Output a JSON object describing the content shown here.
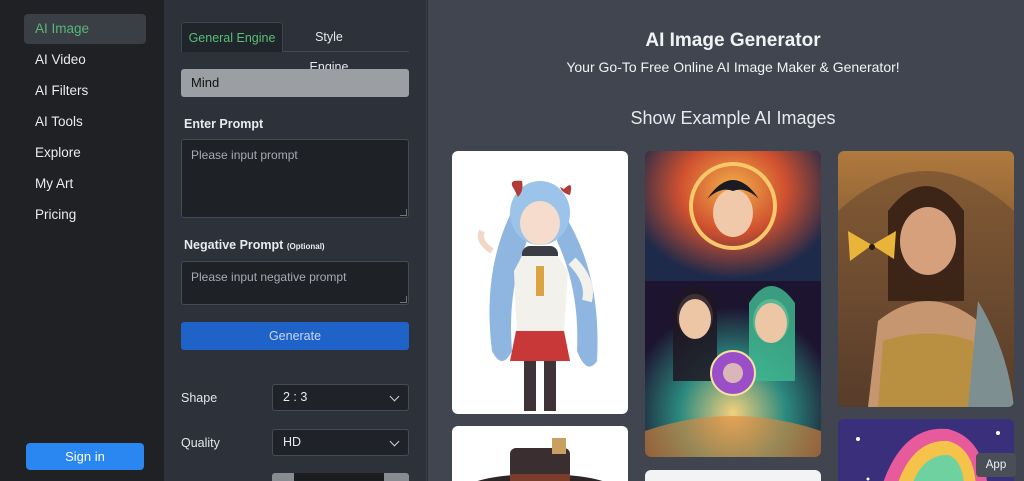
{
  "nav": {
    "items": [
      {
        "label": "AI Image",
        "active": true
      },
      {
        "label": "AI Video"
      },
      {
        "label": "AI Filters"
      },
      {
        "label": "AI Tools"
      },
      {
        "label": "Explore"
      },
      {
        "label": "My Art"
      },
      {
        "label": "Pricing"
      }
    ],
    "signin_label": "Sign in"
  },
  "form": {
    "tabs": [
      {
        "label": "General Engine"
      },
      {
        "label": "Style Engine"
      }
    ],
    "model_value": "Mind",
    "prompt_label": "Enter Prompt",
    "prompt_placeholder": "Please input prompt",
    "negative_label": "Negative Prompt",
    "negative_optional": "(Optional)",
    "negative_placeholder": "Please input negative prompt",
    "generate_label": "Generate",
    "shape_label": "Shape",
    "shape_value": "2 : 3",
    "quality_label": "Quality",
    "quality_value": "HD"
  },
  "main": {
    "title": "AI Image Generator",
    "subtitle": "Your Go-To Free Online AI Image Maker & Generator!",
    "section_title": "Show Example AI Images",
    "app_label": "App"
  },
  "colors": {
    "accent_green": "#57b874",
    "primary_blue": "#2a86f0",
    "generate_blue": "#1f63c9"
  }
}
